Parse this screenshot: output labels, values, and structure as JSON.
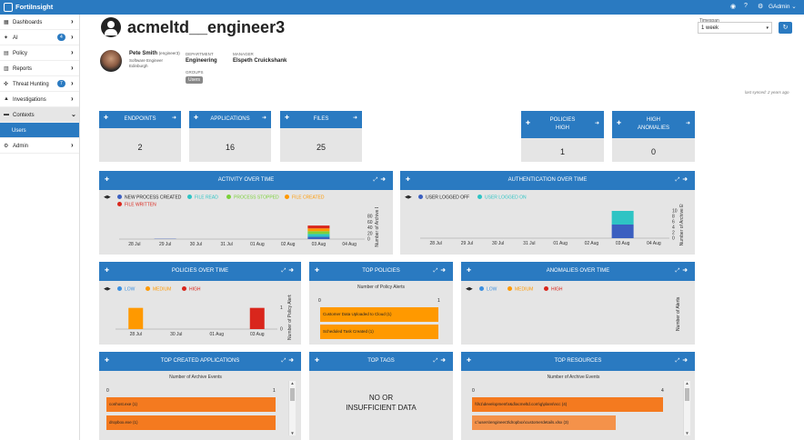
{
  "app": {
    "title": "FortiInsight",
    "user": "GAdmin ⌄"
  },
  "sidebar": {
    "items": [
      {
        "label": "Dashboards",
        "glyph": "▦"
      },
      {
        "label": "AI",
        "glyph": "✦",
        "badge": "4"
      },
      {
        "label": "Policy",
        "glyph": "▤"
      },
      {
        "label": "Reports",
        "glyph": "▥"
      },
      {
        "label": "Threat Hunting",
        "glyph": "✜",
        "badge": "7"
      },
      {
        "label": "Investigations",
        "glyph": "▲"
      },
      {
        "label": "Contexts",
        "glyph": "▬"
      },
      {
        "label": "Users",
        "glyph": ""
      },
      {
        "label": "Admin",
        "glyph": "⚙"
      }
    ]
  },
  "header": {
    "title": "acmeltd__engineer3",
    "timespan_label": "Timespan",
    "timespan_value": "1 week",
    "last_synced": "last synced: 2 years ago"
  },
  "person": {
    "name": "Pete Smith",
    "username": "(engineer3)",
    "role": "Software Engineer",
    "location": "Edinburgh",
    "department_label": "DEPARTMENT",
    "department": "Engineering",
    "manager_label": "MANAGER",
    "manager": "Elspeth Cruickshank",
    "groups_label": "GROUPS",
    "group": "Users"
  },
  "stats": [
    {
      "label": "ENDPOINTS",
      "value": "2"
    },
    {
      "label": "APPLICATIONS",
      "value": "16"
    },
    {
      "label": "FILES",
      "value": "25"
    },
    {
      "label": "POLICIES",
      "label2": "HIGH",
      "value": "1"
    },
    {
      "label": "HIGH",
      "label2": "ANOMALIES",
      "value": "0"
    }
  ],
  "panels": {
    "activity": {
      "title": "ACTIVITY OVER TIME",
      "legend": [
        "NEW PROCESS CREATED",
        "FILE READ",
        "PROCESS STOPPED",
        "FILE CREATED",
        "FILE WRITTEN"
      ],
      "ylabel": "Number of Archive Ev"
    },
    "auth": {
      "title": "AUTHENTICATION OVER TIME",
      "legend": [
        "USER LOGGED OFF",
        "USER LOGGED ON"
      ],
      "ylabel": "Number of Archive Ever"
    },
    "policies": {
      "title": "POLICIES OVER TIME",
      "legend": [
        "LOW",
        "MEDIUM",
        "HIGH"
      ],
      "ylabel": "Number of Policy Alerts"
    },
    "top_policies": {
      "title": "TOP POLICIES",
      "axis_title": "Number of Policy Alerts",
      "axis_min": "0",
      "axis_max": "1",
      "bars": [
        "Customer Data Uploaded to Cloud (1)",
        "Scheduled Task Created (1)"
      ]
    },
    "anomalies": {
      "title": "ANOMALIES OVER TIME",
      "legend": [
        "LOW",
        "MEDIUM",
        "HIGH"
      ],
      "ylabel": "Number of Alerts"
    },
    "top_apps": {
      "title": "TOP CREATED APPLICATIONS",
      "axis_title": "Number of Archive Events",
      "axis_min": "0",
      "axis_max": "1",
      "bars": [
        "conhost.exe (1)",
        "dropbox.exe (1)"
      ]
    },
    "top_tags": {
      "title": "TOP TAGS",
      "nodata_1": "NO OR",
      "nodata_2": "INSUFFICIENT DATA"
    },
    "top_resources": {
      "title": "TOP RESOURCES",
      "axis_title": "Number of Archive Events",
      "axis_min": "0",
      "axis_max": "4",
      "bars": [
        "\\\\fs1\\development\\r&d\\acmeltd.com\\g\\plans\\ncc (4)",
        "c:\\users\\engineer3\\dropbox\\customerdetails.xlsx (3)"
      ]
    }
  },
  "chart_data": [
    {
      "type": "bar",
      "title": "ACTIVITY OVER TIME",
      "stacked": true,
      "categories": [
        "28 Jul",
        "29 Jul",
        "30 Jul",
        "31 Jul",
        "01 Aug",
        "02 Aug",
        "03 Aug",
        "04 Aug"
      ],
      "ylabel": "Number of Archive Ev",
      "ylim": [
        0,
        100
      ],
      "yticks": [
        "0",
        "20",
        "40",
        "60",
        "80"
      ],
      "series": [
        {
          "name": "NEW PROCESS CREATED",
          "color": "#3b5fc0",
          "values": [
            0,
            1,
            0,
            0,
            0,
            0,
            8,
            0
          ]
        },
        {
          "name": "FILE READ",
          "color": "#2ec4c4",
          "values": [
            0,
            0,
            0,
            0,
            0,
            0,
            10,
            0
          ]
        },
        {
          "name": "PROCESS STOPPED",
          "color": "#7bd13a",
          "values": [
            0,
            0,
            0,
            0,
            0,
            0,
            10,
            0
          ]
        },
        {
          "name": "FILE CREATED",
          "color": "#ff9900",
          "values": [
            0,
            0,
            0,
            0,
            0,
            0,
            10,
            0
          ]
        },
        {
          "name": "FILE WRITTEN",
          "color": "#d9261c",
          "values": [
            0,
            0,
            0,
            0,
            0,
            0,
            10,
            0
          ]
        }
      ]
    },
    {
      "type": "bar",
      "title": "AUTHENTICATION OVER TIME",
      "stacked": true,
      "categories": [
        "28 Jul",
        "29 Jul",
        "30 Jul",
        "31 Jul",
        "01 Aug",
        "02 Aug",
        "03 Aug",
        "04 Aug"
      ],
      "ylabel": "Number of Archive Ever",
      "ylim": [
        0,
        12
      ],
      "yticks": [
        "0",
        "2",
        "4",
        "6",
        "8",
        "10"
      ],
      "series": [
        {
          "name": "USER LOGGED OFF",
          "color": "#3b5fc0",
          "values": [
            0,
            0,
            0,
            0,
            0,
            0,
            5,
            0
          ]
        },
        {
          "name": "USER LOGGED ON",
          "color": "#2ec4c4",
          "values": [
            0,
            0,
            0,
            0,
            0,
            0,
            5,
            0
          ]
        }
      ]
    },
    {
      "type": "bar",
      "title": "POLICIES OVER TIME",
      "stacked": true,
      "categories": [
        "28 Jul",
        "30 Jul",
        "01 Aug",
        "03 Aug"
      ],
      "ylabel": "Number of Policy Alerts",
      "ylim": [
        0,
        1.2
      ],
      "yticks": [
        "0",
        "1"
      ],
      "series": [
        {
          "name": "LOW",
          "color": "#3b8fe0",
          "values": [
            0,
            0,
            0,
            0
          ]
        },
        {
          "name": "MEDIUM",
          "color": "#ff9900",
          "values": [
            1,
            0,
            0,
            0
          ]
        },
        {
          "name": "HIGH",
          "color": "#d9261c",
          "values": [
            0,
            0,
            0,
            1
          ]
        }
      ]
    },
    {
      "type": "bar",
      "title": "TOP POLICIES",
      "orientation": "horizontal",
      "categories": [
        "Customer Data Uploaded to Cloud (1)",
        "Scheduled Task Created (1)"
      ],
      "values": [
        1,
        1
      ],
      "xlim": [
        0,
        1
      ]
    },
    {
      "type": "bar",
      "title": "TOP CREATED APPLICATIONS",
      "orientation": "horizontal",
      "categories": [
        "conhost.exe (1)",
        "dropbox.exe (1)"
      ],
      "values": [
        1,
        1
      ],
      "xlim": [
        0,
        1
      ]
    },
    {
      "type": "bar",
      "title": "TOP RESOURCES",
      "orientation": "horizontal",
      "categories": [
        "\\\\fs1\\development\\r&d\\acmeltd.com\\g\\plans\\ncc (4)",
        "c:\\users\\engineer3\\dropbox\\customerdetails.xlsx (3)"
      ],
      "values": [
        4,
        3
      ],
      "xlim": [
        0,
        4
      ]
    }
  ]
}
